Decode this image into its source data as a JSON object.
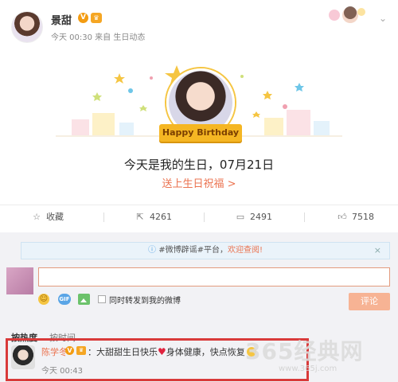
{
  "post": {
    "user_name": "景甜",
    "verified_badge": "V",
    "meta": "今天 00:30 来自 生日动态",
    "menu_icon": "chevron-down-icon"
  },
  "birthday_card": {
    "ribbon_text": "Happy Birthday",
    "message": "今天是我的生日，07月21日",
    "link": "送上生日祝福 >"
  },
  "actions": {
    "favorite_label": "收藏",
    "repost_count": "4261",
    "comment_count": "2491",
    "like_count": "7518"
  },
  "notice": {
    "prefix": "#微博辟谣#平台，",
    "link": "欢迎查阅!",
    "close": "×"
  },
  "composer": {
    "input_value": "",
    "gif_label": "GIF",
    "also_repost_label": "同时转发到我的微博",
    "submit_label": "评论"
  },
  "tabs": {
    "hot": "按热度",
    "time": "按时间"
  },
  "comment": {
    "user_name": "陈学冬",
    "verified_badge": "V",
    "text_before_heart": "：大甜甜生日快乐",
    "text_after_heart": "身体健康，快点恢复",
    "time": "今天 00:43"
  },
  "watermark": {
    "text": "365经典网",
    "url": "www.365j.com"
  },
  "colors": {
    "accent": "#eb7350",
    "highlight_border": "#d93a3a",
    "gold": "#f5b623"
  }
}
